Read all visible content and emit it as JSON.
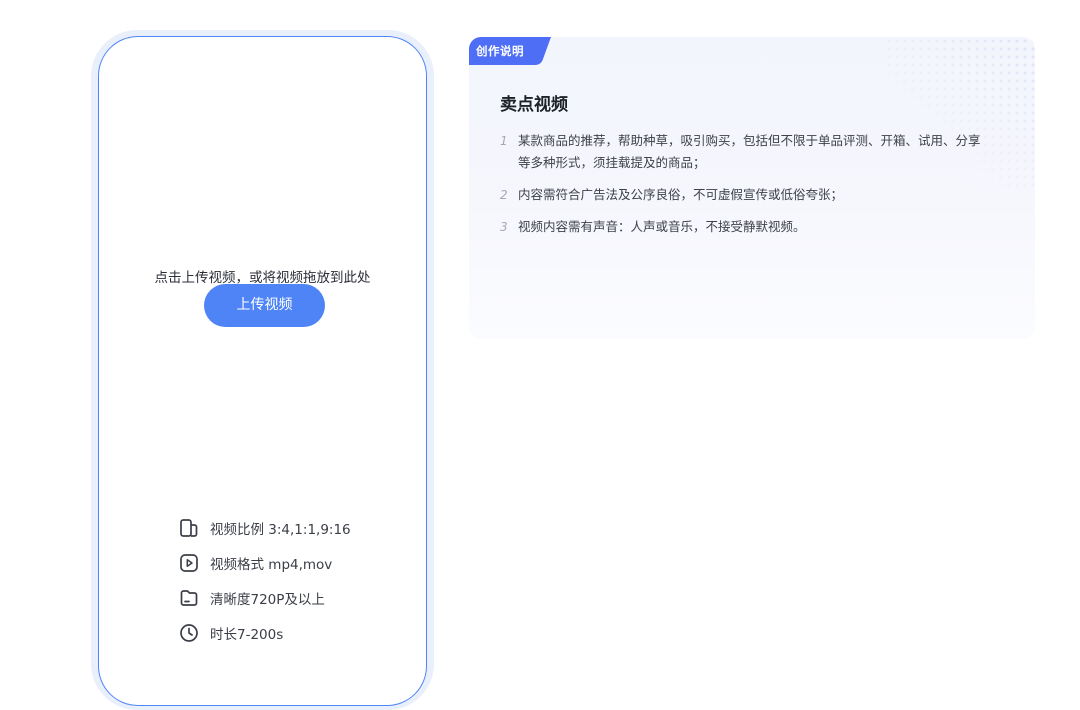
{
  "upload": {
    "hint": "点击上传视频，或将视频拖放到此处",
    "button_label": "上传视频",
    "specs": [
      {
        "icon": "aspect-ratio-icon",
        "text": "视频比例 3:4,1:1,9:16"
      },
      {
        "icon": "video-format-icon",
        "text": "视频格式 mp4,mov"
      },
      {
        "icon": "resolution-icon",
        "text": "清晰度720P及以上"
      },
      {
        "icon": "clock-icon",
        "text": "时长7-200s"
      }
    ]
  },
  "guide": {
    "badge": "创作说明",
    "title": "卖点视频",
    "items": [
      {
        "num": "1",
        "text": "某款商品的推荐，帮助种草，吸引购买，包括但不限于单品评测、开箱、试用、分享等多种形式，须挂载提及的商品；"
      },
      {
        "num": "2",
        "text": "内容需符合广告法及公序良俗，不可虚假宣传或低俗夸张；"
      },
      {
        "num": "3",
        "text": "视频内容需有声音：人声或音乐，不接受静默视频。"
      }
    ]
  },
  "colors": {
    "accent": "#4e84f5",
    "frame_border": "#4f86f7",
    "frame_glow": "#e9f0fc",
    "badge": "#4d6ef5",
    "guide_bg": "#f4f6fd"
  }
}
